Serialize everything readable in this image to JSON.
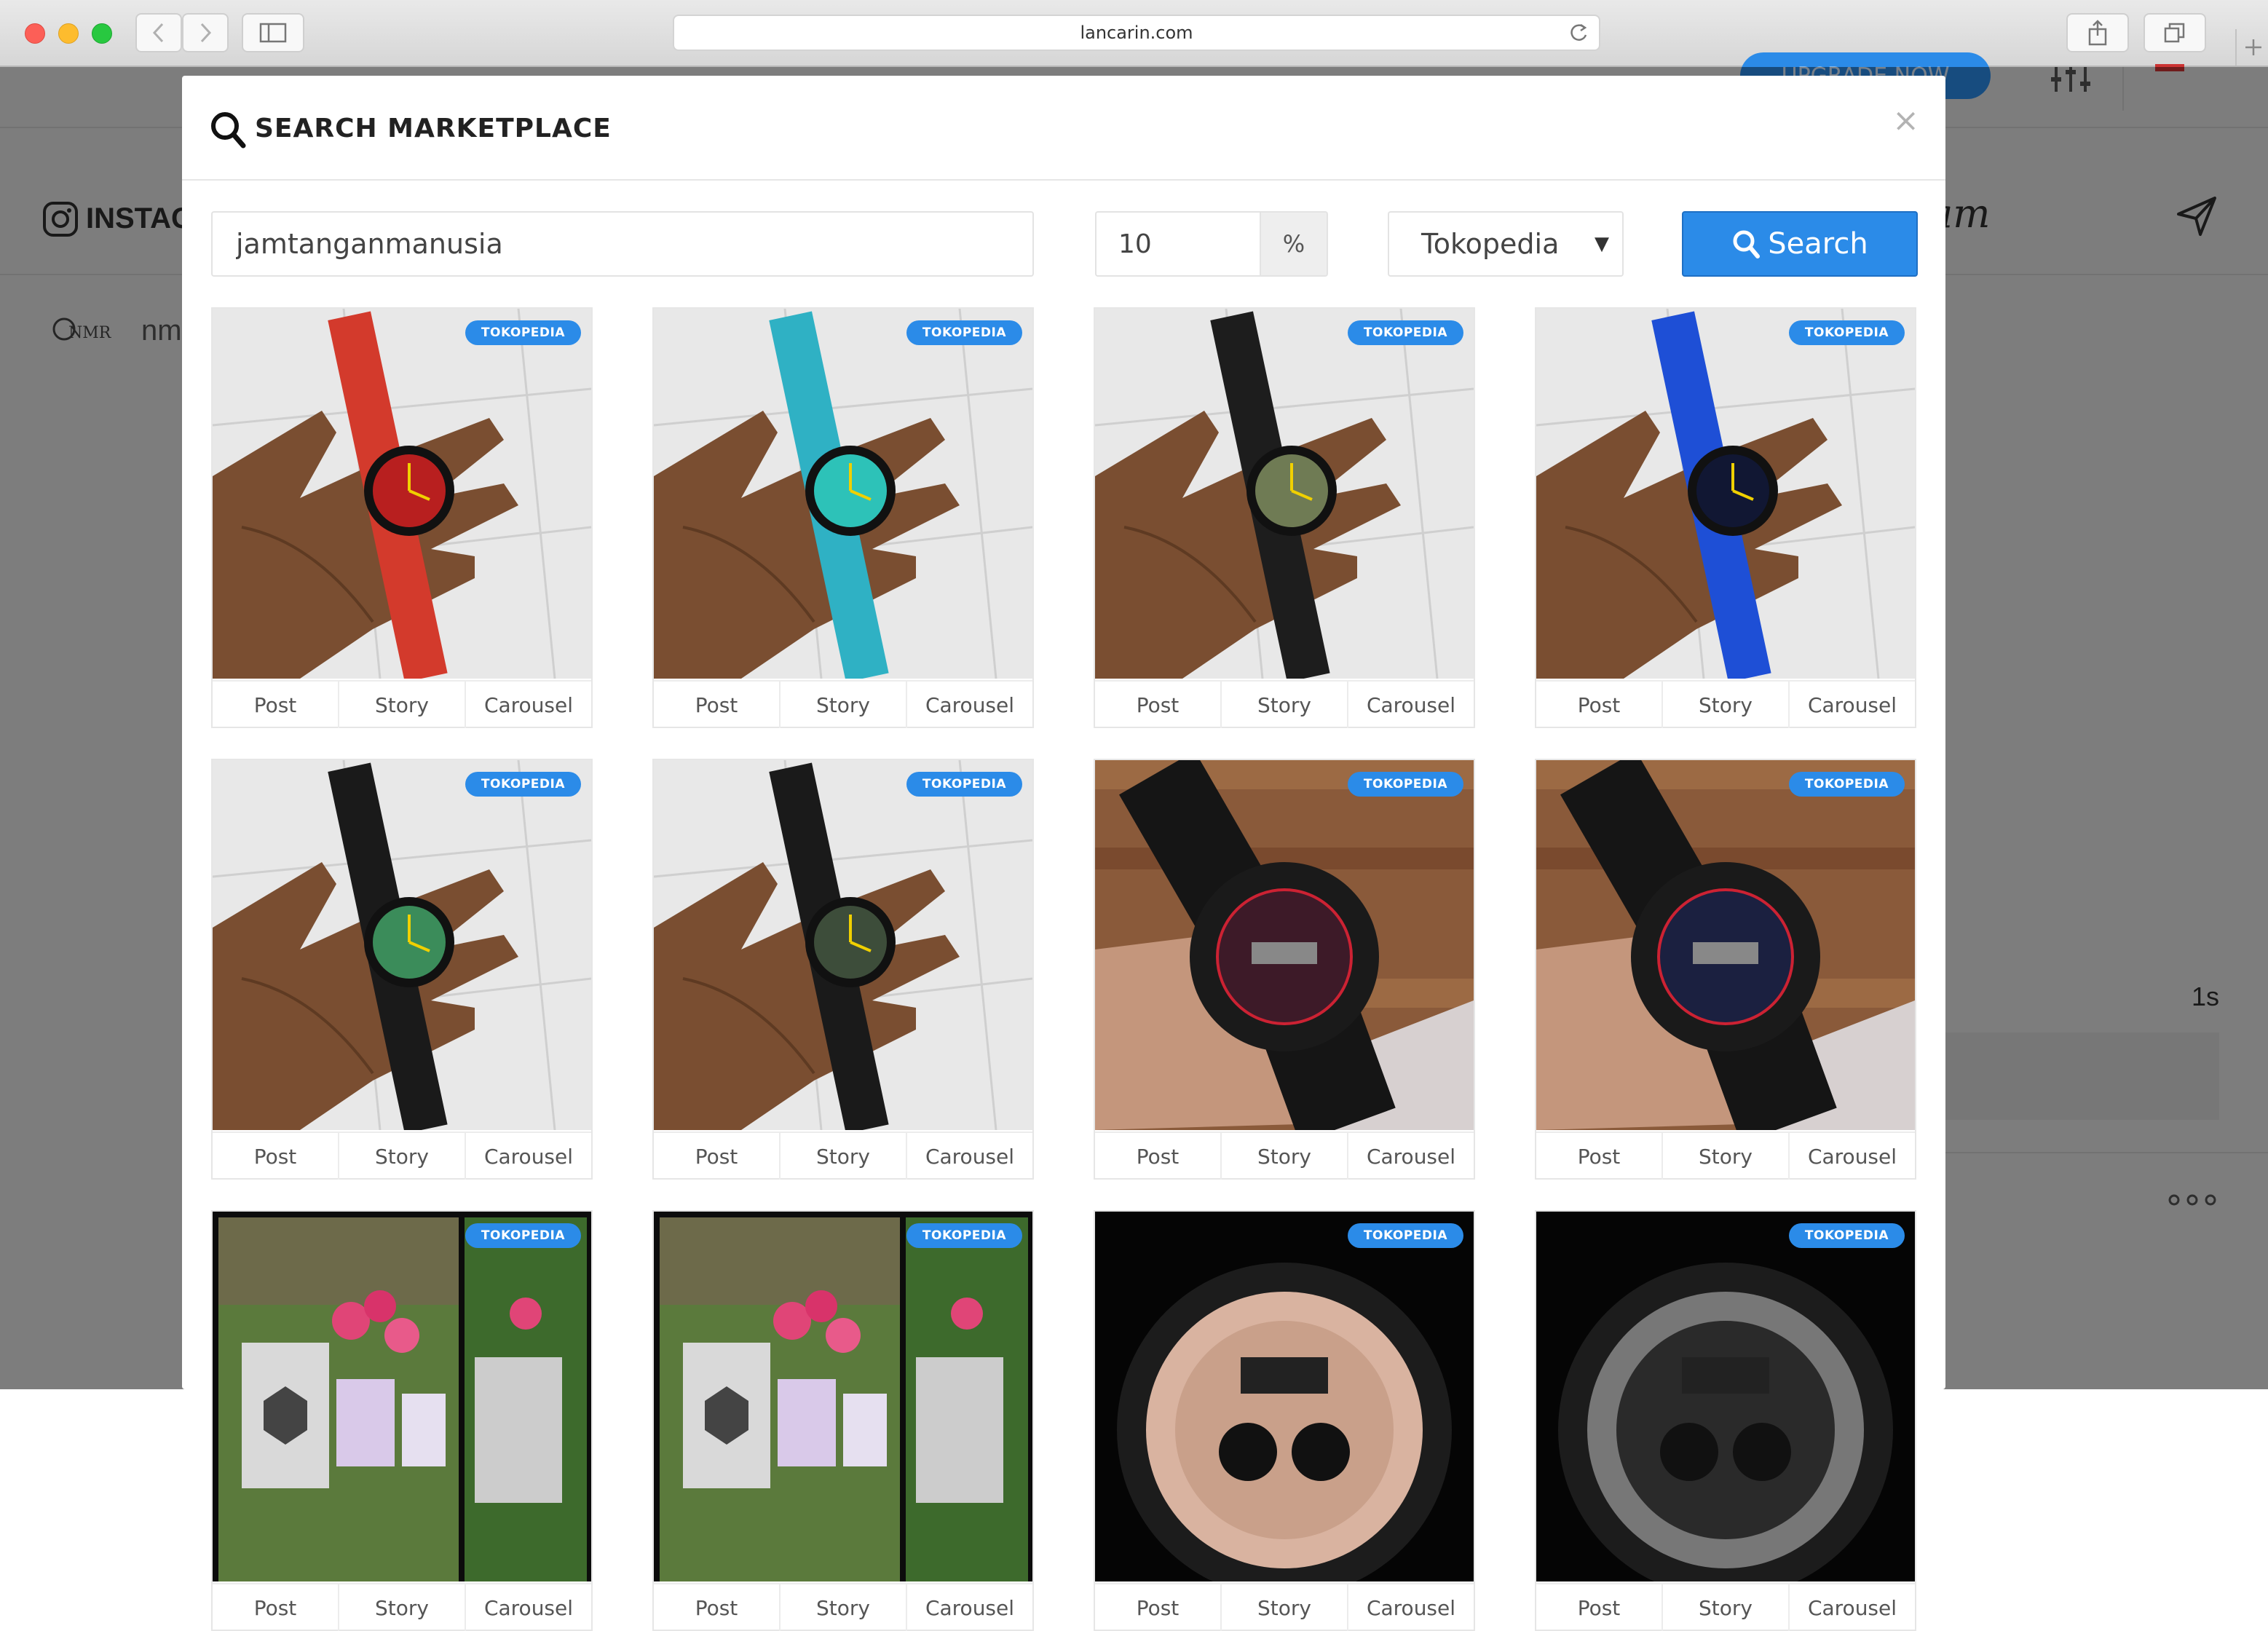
{
  "browser": {
    "url": "lancarin.com"
  },
  "background": {
    "instagram_label": "INSTAG",
    "brand_text": "nm",
    "script_text": "am",
    "right_number": "1s",
    "upgrade_label": "UPGRADE NOW"
  },
  "modal": {
    "title": "SEARCH MARKETPLACE",
    "close_glyph": "×",
    "keyword_value": "jamtanganmanusia",
    "percent_value": "10",
    "percent_symbol": "%",
    "marketplace_selected": "Tokopedia",
    "search_label": "Search"
  },
  "products": [
    {
      "badge": "TOKOPEDIA",
      "strap": "#d33a2c",
      "face": "#b81f1f"
    },
    {
      "badge": "TOKOPEDIA",
      "strap": "#2fb1c4",
      "face": "#2dc2b8"
    },
    {
      "badge": "TOKOPEDIA",
      "strap": "#1d1d1d",
      "face": "#6f7b54"
    },
    {
      "badge": "TOKOPEDIA",
      "strap": "#1e4fd6",
      "face": "#111733"
    },
    {
      "badge": "TOKOPEDIA",
      "strap": "#1a1a1a",
      "face": "#3b8c5a"
    },
    {
      "badge": "TOKOPEDIA",
      "strap": "#1a1a1a",
      "face": "#3d4d3a"
    },
    {
      "badge": "TOKOPEDIA",
      "strap": "#151515",
      "face": "#3d1a28"
    },
    {
      "badge": "TOKOPEDIA",
      "strap": "#151515",
      "face": "#1b2040"
    },
    {
      "badge": "TOKOPEDIA",
      "strap": "#3a5a2a",
      "face": "#c98a9a"
    },
    {
      "badge": "TOKOPEDIA",
      "strap": "#3a5a2a",
      "face": "#c98a9a"
    },
    {
      "badge": "TOKOPEDIA",
      "strap": "#111111",
      "face": "#c9a08a"
    },
    {
      "badge": "TOKOPEDIA",
      "strap": "#111111",
      "face": "#2a2a2a"
    }
  ],
  "card_actions": {
    "post": "Post",
    "story": "Story",
    "carousel": "Carousel"
  },
  "colors": {
    "accent": "#2b8be8",
    "close_red": "#fc5f57",
    "minimize_yellow": "#fdbc2e",
    "maximize_green": "#28c840"
  }
}
